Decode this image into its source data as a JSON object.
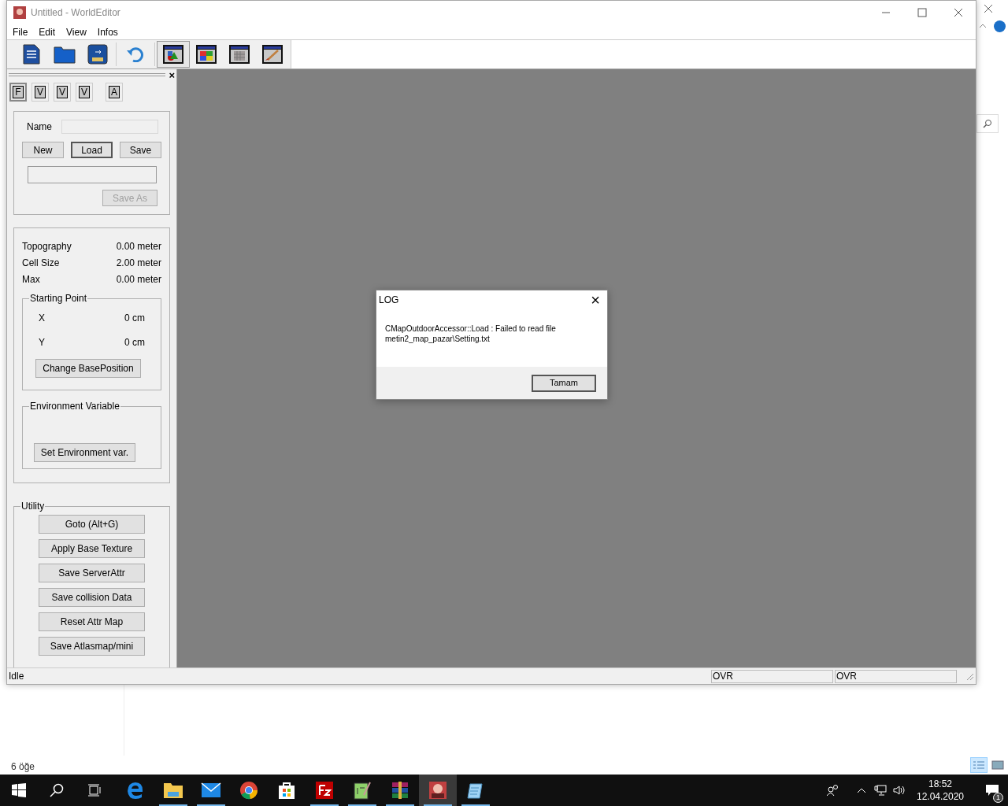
{
  "window": {
    "title": "Untitled - WorldEditor"
  },
  "menu": [
    "File",
    "Edit",
    "View",
    "Infos"
  ],
  "toolbar": {
    "file_tools": [
      {
        "kind": "document"
      },
      {
        "kind": "folder"
      },
      {
        "kind": "disk"
      }
    ],
    "undo": {
      "kind": "undo"
    },
    "modes": [
      {
        "kind": "objects",
        "selected": true
      },
      {
        "kind": "colors",
        "selected": false
      },
      {
        "kind": "grid",
        "selected": false
      },
      {
        "kind": "brush",
        "selected": false
      }
    ]
  },
  "panel": {
    "close": "×",
    "tabs": [
      {
        "label": "F",
        "selected": true
      },
      {
        "label": "V",
        "selected": false
      },
      {
        "label": "V",
        "selected": false
      },
      {
        "label": "V",
        "selected": false
      },
      {
        "label": "A",
        "selected": false
      }
    ],
    "map": {
      "name_label": "Name",
      "buttons": [
        {
          "label": "New",
          "default": false
        },
        {
          "label": "Load",
          "default": true
        },
        {
          "label": "Save",
          "default": false
        }
      ],
      "save_as": {
        "label": "Save As",
        "disabled": true
      }
    },
    "info": [
      {
        "label": "Topography",
        "value": "0.00 meter"
      },
      {
        "label": "Cell Size",
        "value": "2.00 meter"
      },
      {
        "label": "Max",
        "value": "0.00 meter"
      }
    ],
    "starting_point": {
      "title": "Starting Point",
      "coords": [
        {
          "label": "X",
          "value": "0 cm"
        },
        {
          "label": "Y",
          "value": "0 cm"
        }
      ],
      "button": "Change BasePosition"
    },
    "environment": {
      "title": "Environment Variable",
      "button": "Set Environment var."
    },
    "utility": {
      "title": "Utility",
      "buttons": [
        "Goto (Alt+G)",
        "Apply Base Texture",
        "Save ServerAttr",
        "Save collision Data",
        "Reset Attr Map",
        "Save Atlasmap/mini"
      ]
    }
  },
  "status_bar": {
    "text": "Idle",
    "panes": [
      "OVR",
      "OVR"
    ]
  },
  "dialog": {
    "title": "LOG",
    "close": "×",
    "message": [
      "CMapOutdoorAccessor::Load : Failed to read file",
      "metin2_map_pazar\\Setting.txt"
    ],
    "button": "Tamam"
  },
  "explorer": {
    "item_count": "6 öğe",
    "views": [
      {
        "kind": "details",
        "selected": true
      },
      {
        "kind": "large",
        "selected": false
      }
    ]
  },
  "taskbar": {
    "apps": [
      {
        "kind": "edge",
        "running": false,
        "selected": false
      },
      {
        "kind": "folder",
        "running": true,
        "selected": false
      },
      {
        "kind": "mail",
        "running": true,
        "selected": false
      },
      {
        "kind": "chrome",
        "running": false,
        "selected": false
      },
      {
        "kind": "store",
        "running": false,
        "selected": false
      },
      {
        "kind": "ftp",
        "running": true,
        "selected": false
      },
      {
        "kind": "notepad",
        "running": true,
        "selected": false
      },
      {
        "kind": "archive",
        "running": true,
        "selected": false
      },
      {
        "kind": "app",
        "running": true,
        "selected": true
      },
      {
        "kind": "pad",
        "running": true,
        "selected": false
      }
    ],
    "time": "18:52",
    "date": "12.04.2020",
    "notifications": "1"
  }
}
